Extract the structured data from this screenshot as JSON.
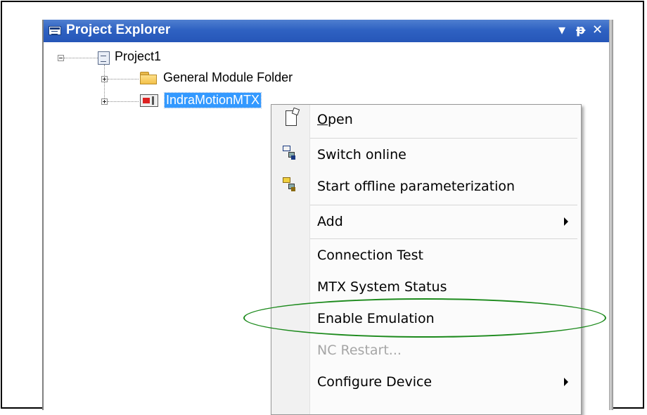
{
  "panel": {
    "title": "Project Explorer",
    "dropdown_glyph": "▾",
    "pin_glyph": "ᵽ",
    "close_glyph": "✕"
  },
  "tree": {
    "root_label": "Project1",
    "children": [
      {
        "label": "General Module Folder",
        "icon": "folder-icon"
      },
      {
        "label": "IndraMotionMTX",
        "icon": "device-icon",
        "selected": true
      }
    ]
  },
  "context_menu": {
    "items": [
      {
        "label_prefix": "",
        "label_accel": "O",
        "label_rest": "pen",
        "icon": "open-file-icon",
        "enabled": true
      },
      {
        "label": "Switch online",
        "icon": "switch-online-icon",
        "enabled": true
      },
      {
        "label": "Start offline parameterization",
        "icon": "offline-param-icon",
        "enabled": true
      },
      {
        "label": "Add",
        "submenu": true,
        "enabled": true
      },
      {
        "label": "Connection Test",
        "enabled": true
      },
      {
        "label": "MTX System Status",
        "enabled": true
      },
      {
        "label": "Enable Emulation",
        "enabled": true,
        "highlighted_by_annotation": true
      },
      {
        "label": "NC Restart...",
        "enabled": false
      },
      {
        "label": "Configure Device",
        "submenu": true,
        "enabled": true
      }
    ]
  },
  "colors": {
    "titlebar": "#2f62c2",
    "selection": "#3399ff",
    "annotation_ellipse": "#1c8a1c",
    "disabled_text": "#a6a6a6"
  }
}
